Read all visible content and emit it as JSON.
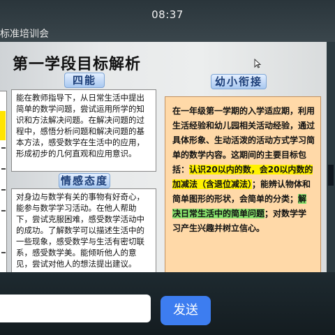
{
  "status_bar": {
    "time": "08:37"
  },
  "meeting": {
    "title": "标准培训会"
  },
  "slide": {
    "title": "第一学段目标解析",
    "section_four_abilities": {
      "heading": "四能",
      "text": "能在教师指导下，从日常生活中提出简单的数学问题，尝试运用所学的知识和方法解决问题。在解决问题的过程中，感悟分析问题和解决问题的基本方法，感受数学在生活中的应用，形成初步的几何直观和应用意识。"
    },
    "section_emotion": {
      "heading": "情感态度",
      "text": "对身边与数学有关的事物有好奇心，能参与数学学习活动。在他人帮助下，尝试克服困难，感受数学活动中的成功。了解数学可以描述生活中的一些现象，感受数学与生活有密切联系，感受数学美。能倾听他人的意见，尝试对他人的想法提出建议。"
    },
    "section_transition": {
      "heading": "幼小衔接",
      "text_part1": "在一年级第一学期的入学适应期，利用生活经验和幼儿园相关活动经验，通过具体形象、生动活泼的活动方式学习简单的数学内容。这期间的主要目标包括：",
      "highlight_yellow": "认识20以内的数，会20以内数的加减法（含退位减法）",
      "text_part2": "；能辨认物体和简单图形的形状，会简单的分类；",
      "highlight_green": "解决日常生活中的简单问题",
      "text_part3": "；对数学学习产生兴趣并树立信心。"
    }
  },
  "chat": {
    "input_placeholder": "",
    "send_label": "发送"
  },
  "colors": {
    "send_button": "#3d7df0",
    "transition_box": "#ffd9a8",
    "highlight_yellow": "#fff200",
    "highlight_green": "#86e06b",
    "heading_text": "#1c3e78"
  },
  "icons": [
    "mouse-pointer-icon"
  ]
}
